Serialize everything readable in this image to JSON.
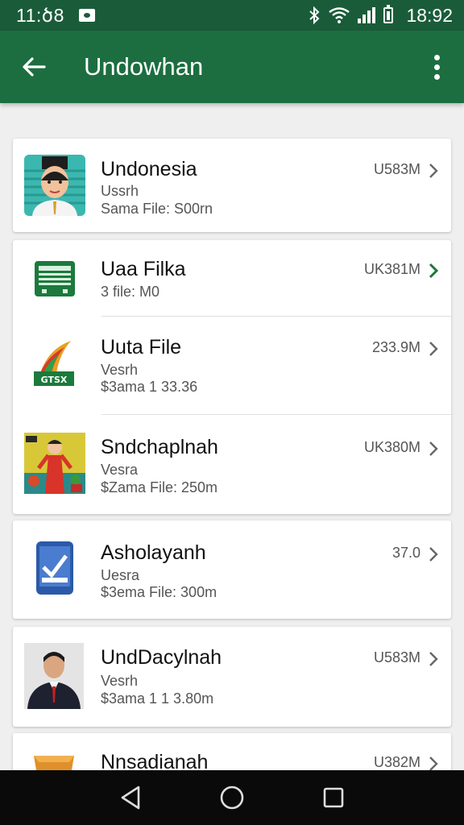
{
  "status_bar": {
    "time_left": "11:ծ8",
    "time_right": "18:92"
  },
  "app_bar": {
    "title": "Undowhan"
  },
  "colors": {
    "primary": "#1c6e40",
    "status": "#1a5c39",
    "accent": "#1a7a3a"
  },
  "cards": [
    {
      "items": [
        {
          "title": "Undonesia",
          "line1": "Ussrh",
          "line2": "Sama File: S00rn",
          "size": "U583M",
          "icon": "portrait-woman-icon"
        }
      ]
    },
    {
      "items": [
        {
          "title": "Uaa Filka",
          "line1": "3 file: M0",
          "line2": "",
          "size": "UK381M",
          "icon": "spreadsheet-icon",
          "chevron_accent": true
        },
        {
          "title": "Uuta File",
          "line1": "Vesrh",
          "line2": "$3ama 1 33.36",
          "size": "233.9M",
          "icon": "flag-logo-icon"
        },
        {
          "title": "Sndchaplnah",
          "line1": "Vesra",
          "line2": "$Zama File: 250m",
          "size": "UK380M",
          "icon": "cultural-poster-icon"
        }
      ]
    },
    {
      "items": [
        {
          "title": "Asholayanh",
          "line1": "Uesra",
          "line2": "$3ema File: 300m",
          "size": "37.0",
          "icon": "tablet-checkmark-icon"
        }
      ]
    },
    {
      "items": [
        {
          "title": "UndDacylnah",
          "line1": "Vesrh",
          "line2": "$3ama 1 1 3.80m",
          "size": "U583M",
          "icon": "portrait-man-icon"
        }
      ]
    },
    {
      "items": [
        {
          "title": "Nnsadianah",
          "line1": "",
          "line2": "",
          "size": "U382M",
          "icon": "box-icon"
        }
      ]
    }
  ],
  "nav": {
    "back": "back-icon",
    "home": "home-icon",
    "recents": "recents-icon"
  }
}
